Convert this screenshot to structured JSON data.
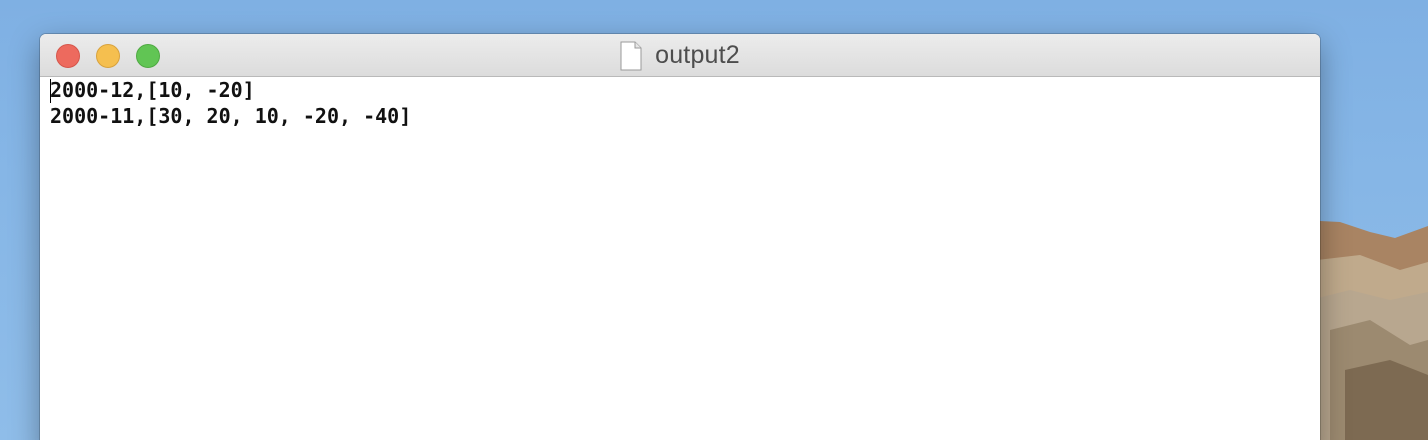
{
  "window": {
    "title": "output2",
    "title_icon": "document-icon"
  },
  "traffic_lights": {
    "close_color": "#ed6a5e",
    "minimize_color": "#f5bf4f",
    "zoom_color": "#61c554"
  },
  "editor": {
    "lines": [
      "2000-12,[10, -20]",
      "2000-11,[30, 20, 10, -20, -40]"
    ]
  }
}
